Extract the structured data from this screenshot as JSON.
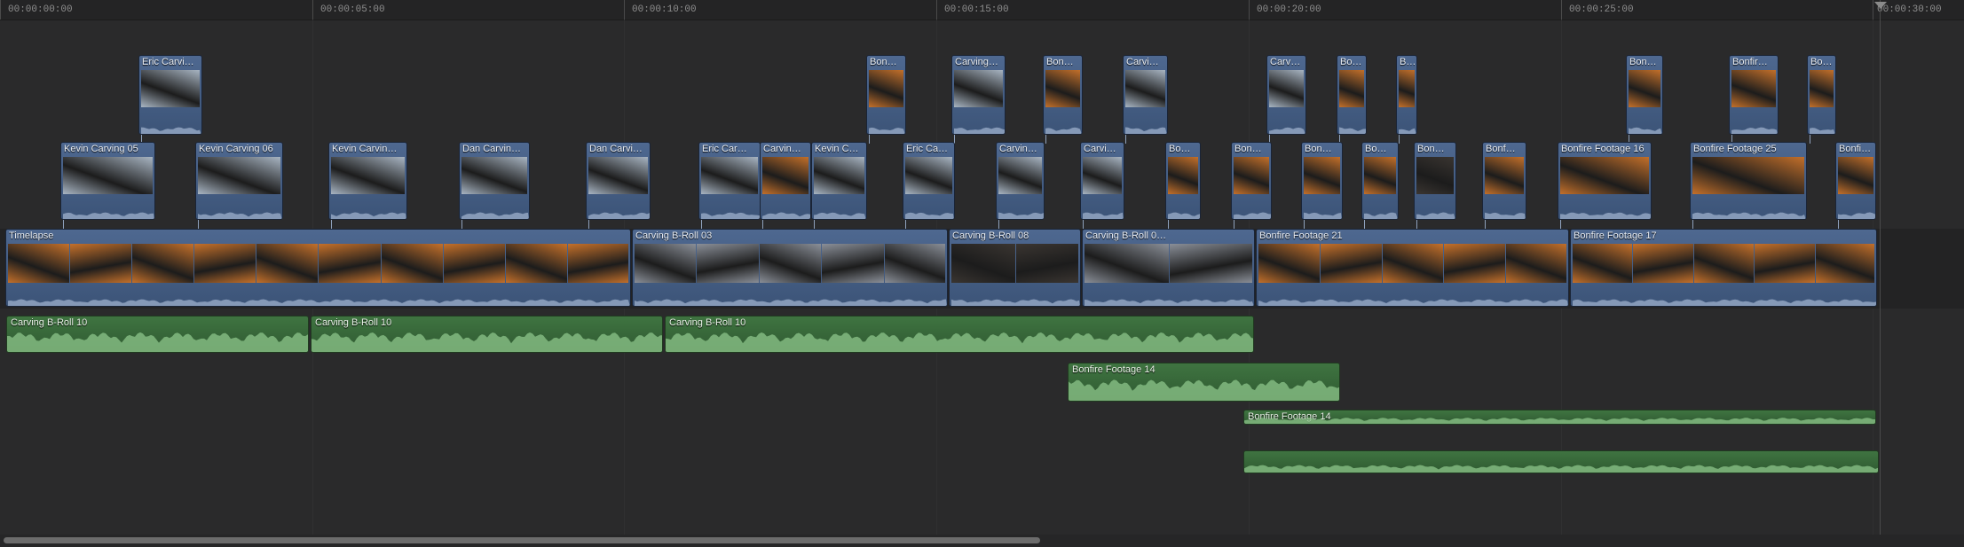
{
  "ruler": {
    "ticks": [
      "00:00:00:00",
      "00:00:05:00",
      "00:00:10:00",
      "00:00:15:00",
      "00:00:20:00",
      "00:00:25:00",
      "00:00:30:00"
    ]
  },
  "colors": {
    "video_clip": "#4b6589",
    "audio_clip": "#3a6b3c",
    "waveform": "#8ec68b",
    "thumb_snow": "#a9b6c4",
    "thumb_fire": "#c4702a",
    "thumb_night": "#3a3531",
    "thumb_crowd": "#8a8f98"
  },
  "connected_clips_upper": [
    {
      "title": "Eric Carvi…",
      "thumb": "thumb_snow"
    },
    {
      "title": "Bon…",
      "thumb": "thumb_fire"
    },
    {
      "title": "Carving…",
      "thumb": "thumb_snow"
    },
    {
      "title": "Bon…",
      "thumb": "thumb_fire"
    },
    {
      "title": "Carvi…",
      "thumb": "thumb_snow"
    },
    {
      "title": "Carv…",
      "thumb": "thumb_snow"
    },
    {
      "title": "Bon…",
      "thumb": "thumb_fire"
    },
    {
      "title": "B…",
      "thumb": "thumb_fire"
    },
    {
      "title": "Bon…",
      "thumb": "thumb_fire"
    },
    {
      "title": "Bonfir…",
      "thumb": "thumb_fire"
    },
    {
      "title": "Bo…",
      "thumb": "thumb_fire"
    }
  ],
  "connected_clips_lower": [
    {
      "title": "Kevin Carving 05",
      "thumb": "thumb_snow"
    },
    {
      "title": "Kevin Carving 06",
      "thumb": "thumb_snow"
    },
    {
      "title": "Kevin Carvin…",
      "thumb": "thumb_snow"
    },
    {
      "title": "Dan Carvin…",
      "thumb": "thumb_snow"
    },
    {
      "title": "Dan Carvi…",
      "thumb": "thumb_snow"
    },
    {
      "title": "Eric Car…",
      "thumb": "thumb_snow"
    },
    {
      "title": "Carvin…",
      "thumb": "thumb_fire"
    },
    {
      "title": "Kevin C…",
      "thumb": "thumb_snow"
    },
    {
      "title": "Eric Ca…",
      "thumb": "thumb_snow"
    },
    {
      "title": "Carvin…",
      "thumb": "thumb_snow"
    },
    {
      "title": "Carvi…",
      "thumb": "thumb_snow"
    },
    {
      "title": "Bo…",
      "thumb": "thumb_fire"
    },
    {
      "title": "Bon…",
      "thumb": "thumb_fire"
    },
    {
      "title": "Bon…",
      "thumb": "thumb_fire"
    },
    {
      "title": "Bo…",
      "thumb": "thumb_fire"
    },
    {
      "title": "Bon…",
      "thumb": "thumb_night"
    },
    {
      "title": "Bonf…",
      "thumb": "thumb_fire"
    },
    {
      "title": "Bonfire Footage 16",
      "thumb": "thumb_fire"
    },
    {
      "title": "Bonfire Footage 25",
      "thumb": "thumb_fire"
    },
    {
      "title": "Bonfi…",
      "thumb": "thumb_fire"
    }
  ],
  "primary_storyline": [
    {
      "title": "Timelapse",
      "thumb": "thumb_fire"
    },
    {
      "title": "Carving B-Roll 03",
      "thumb": "thumb_crowd"
    },
    {
      "title": "Carving B-Roll 08",
      "thumb": "thumb_night"
    },
    {
      "title": "Carving B-Roll 0…",
      "thumb": "thumb_crowd"
    },
    {
      "title": "Bonfire Footage 21",
      "thumb": "thumb_fire"
    },
    {
      "title": "Bonfire Footage 17",
      "thumb": "thumb_fire"
    }
  ],
  "audio_clips": [
    {
      "title": "Carving B-Roll 10"
    },
    {
      "title": "Carving B-Roll 10"
    },
    {
      "title": "Carving B-Roll 10"
    },
    {
      "title": "Bonfire Footage 14"
    },
    {
      "title": "Bonfire Footage 14"
    },
    {
      "title": ""
    }
  ]
}
